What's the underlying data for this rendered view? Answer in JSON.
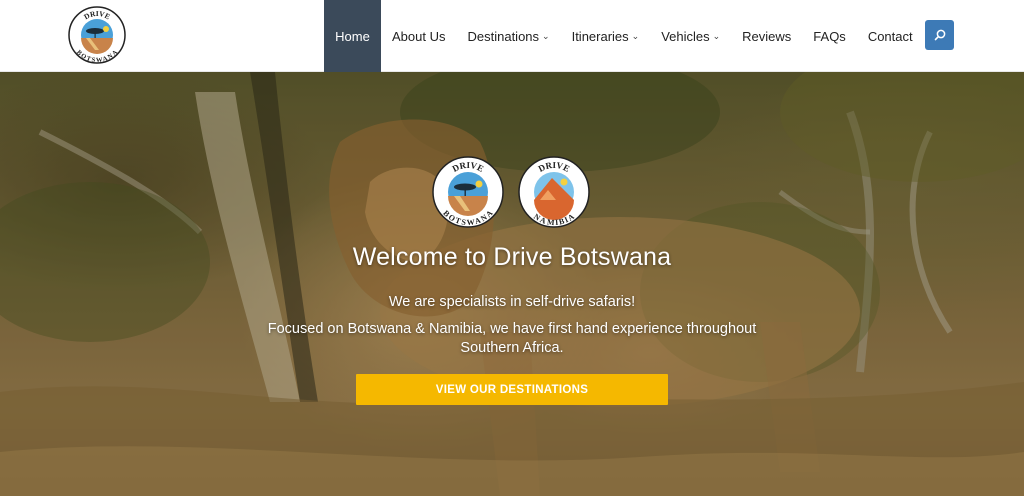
{
  "header": {
    "logo_text_top": "DRIVE",
    "logo_text_bottom": "BOTSWANA",
    "nav": [
      {
        "label": "Home",
        "active": true
      },
      {
        "label": "About Us"
      },
      {
        "label": "Destinations",
        "dropdown": true
      },
      {
        "label": "Itineraries",
        "dropdown": true
      },
      {
        "label": "Vehicles",
        "dropdown": true
      },
      {
        "label": "Reviews"
      },
      {
        "label": "FAQs"
      },
      {
        "label": "Contact"
      }
    ],
    "search_icon": "search-icon",
    "accent_color": "#3d7ab6",
    "active_nav_color": "#3b4a5a"
  },
  "hero": {
    "badges": [
      {
        "top": "DRIVE",
        "bottom": "BOTSWANA"
      },
      {
        "top": "DRIVE",
        "bottom": "NAMIBIA"
      }
    ],
    "title": "Welcome to Drive Botswana",
    "subtitle": "We are specialists in self-drive safaris!",
    "description": "Focused on Botswana & Namibia, we have first hand experience throughout Southern Africa.",
    "cta_label": "VIEW OUR DESTINATIONS",
    "cta_color": "#f5b800"
  }
}
